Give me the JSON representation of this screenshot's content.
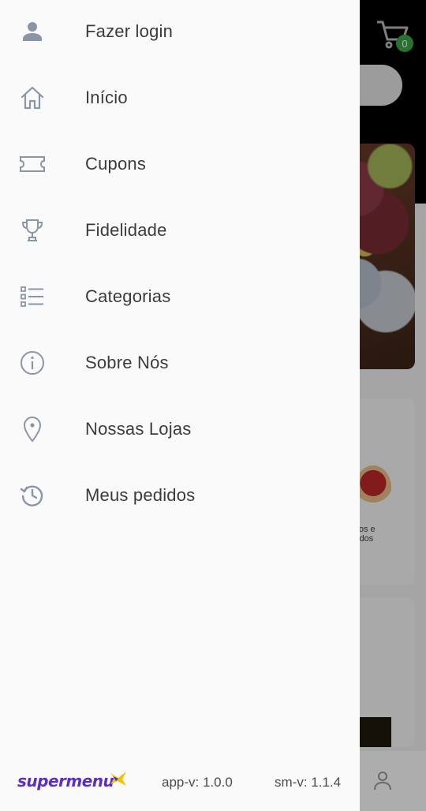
{
  "menu": {
    "items": [
      {
        "label": "Fazer login",
        "icon": "person-icon"
      },
      {
        "label": "Início",
        "icon": "home-icon"
      },
      {
        "label": "Cupons",
        "icon": "ticket-icon"
      },
      {
        "label": "Fidelidade",
        "icon": "trophy-icon"
      },
      {
        "label": "Categorias",
        "icon": "list-icon"
      },
      {
        "label": "Sobre Nós",
        "icon": "info-icon"
      },
      {
        "label": "Nossas Lojas",
        "icon": "location-pin-icon"
      },
      {
        "label": "Meus pedidos",
        "icon": "history-icon"
      }
    ]
  },
  "footer": {
    "logo_text": "supermenu",
    "app_version": "app-v: 1.0.0",
    "sm_version": "sm-v: 1.1.4"
  },
  "background": {
    "cart_count": "0",
    "card_text": "ijos e\ntidos"
  },
  "colors": {
    "drawer_bg": "#fafafa",
    "icon": "#8a96a8",
    "text": "#3b3b3b",
    "brand": "#5a2fc2",
    "brand_accent": "#f2c200",
    "badge": "#3aa845"
  }
}
